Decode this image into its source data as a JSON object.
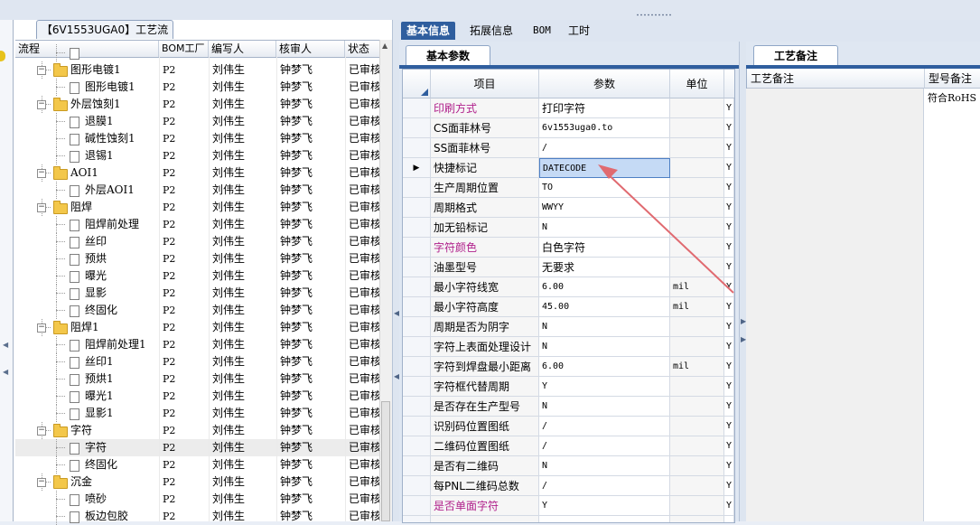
{
  "tree_tab_title": "【6V1553UGA0】工艺流程",
  "tree_columns": [
    "流程",
    "BOM工厂",
    "编写人",
    "核审人",
    "状态"
  ],
  "tree_rows": [
    {
      "level": 0,
      "type": "partial",
      "name": "",
      "factory": "",
      "writer": "",
      "reviewer": "",
      "status": ""
    },
    {
      "level": 1,
      "type": "folder",
      "name": "图形电镀1",
      "factory": "P2",
      "writer": "刘伟生",
      "reviewer": "钟梦飞",
      "status": "已审核"
    },
    {
      "level": 2,
      "type": "doc",
      "name": "图形电镀1",
      "factory": "P2",
      "writer": "刘伟生",
      "reviewer": "钟梦飞",
      "status": "已审核"
    },
    {
      "level": 1,
      "type": "folder",
      "name": "外层蚀刻1",
      "factory": "P2",
      "writer": "刘伟生",
      "reviewer": "钟梦飞",
      "status": "已审核"
    },
    {
      "level": 2,
      "type": "doc",
      "name": "退膜1",
      "factory": "P2",
      "writer": "刘伟生",
      "reviewer": "钟梦飞",
      "status": "已审核"
    },
    {
      "level": 2,
      "type": "doc",
      "name": "碱性蚀刻1",
      "factory": "P2",
      "writer": "刘伟生",
      "reviewer": "钟梦飞",
      "status": "已审核"
    },
    {
      "level": 2,
      "type": "doc",
      "name": "退锡1",
      "factory": "P2",
      "writer": "刘伟生",
      "reviewer": "钟梦飞",
      "status": "已审核"
    },
    {
      "level": 1,
      "type": "folder",
      "name": "AOI1",
      "factory": "P2",
      "writer": "刘伟生",
      "reviewer": "钟梦飞",
      "status": "已审核"
    },
    {
      "level": 2,
      "type": "doc",
      "name": "外层AOI1",
      "factory": "P2",
      "writer": "刘伟生",
      "reviewer": "钟梦飞",
      "status": "已审核"
    },
    {
      "level": 1,
      "type": "folder",
      "name": "阻焊",
      "factory": "P2",
      "writer": "刘伟生",
      "reviewer": "钟梦飞",
      "status": "已审核"
    },
    {
      "level": 2,
      "type": "doc",
      "name": "阻焊前处理",
      "factory": "P2",
      "writer": "刘伟生",
      "reviewer": "钟梦飞",
      "status": "已审核"
    },
    {
      "level": 2,
      "type": "doc",
      "name": "丝印",
      "factory": "P2",
      "writer": "刘伟生",
      "reviewer": "钟梦飞",
      "status": "已审核"
    },
    {
      "level": 2,
      "type": "doc",
      "name": "预烘",
      "factory": "P2",
      "writer": "刘伟生",
      "reviewer": "钟梦飞",
      "status": "已审核"
    },
    {
      "level": 2,
      "type": "doc",
      "name": "曝光",
      "factory": "P2",
      "writer": "刘伟生",
      "reviewer": "钟梦飞",
      "status": "已审核"
    },
    {
      "level": 2,
      "type": "doc",
      "name": "显影",
      "factory": "P2",
      "writer": "刘伟生",
      "reviewer": "钟梦飞",
      "status": "已审核"
    },
    {
      "level": 2,
      "type": "doc",
      "name": "终固化",
      "factory": "P2",
      "writer": "刘伟生",
      "reviewer": "钟梦飞",
      "status": "已审核"
    },
    {
      "level": 1,
      "type": "folder",
      "name": "阻焊1",
      "factory": "P2",
      "writer": "刘伟生",
      "reviewer": "钟梦飞",
      "status": "已审核"
    },
    {
      "level": 2,
      "type": "doc",
      "name": "阻焊前处理1",
      "factory": "P2",
      "writer": "刘伟生",
      "reviewer": "钟梦飞",
      "status": "已审核"
    },
    {
      "level": 2,
      "type": "doc",
      "name": "丝印1",
      "factory": "P2",
      "writer": "刘伟生",
      "reviewer": "钟梦飞",
      "status": "已审核"
    },
    {
      "level": 2,
      "type": "doc",
      "name": "预烘1",
      "factory": "P2",
      "writer": "刘伟生",
      "reviewer": "钟梦飞",
      "status": "已审核"
    },
    {
      "level": 2,
      "type": "doc",
      "name": "曝光1",
      "factory": "P2",
      "writer": "刘伟生",
      "reviewer": "钟梦飞",
      "status": "已审核"
    },
    {
      "level": 2,
      "type": "doc",
      "name": "显影1",
      "factory": "P2",
      "writer": "刘伟生",
      "reviewer": "钟梦飞",
      "status": "已审核"
    },
    {
      "level": 1,
      "type": "folder",
      "name": "字符",
      "factory": "P2",
      "writer": "刘伟生",
      "reviewer": "钟梦飞",
      "status": "已审核"
    },
    {
      "level": 2,
      "type": "doc",
      "name": "字符",
      "factory": "P2",
      "writer": "刘伟生",
      "reviewer": "钟梦飞",
      "status": "已审核",
      "selected": true
    },
    {
      "level": 2,
      "type": "doc",
      "name": "终固化",
      "factory": "P2",
      "writer": "刘伟生",
      "reviewer": "钟梦飞",
      "status": "已审核"
    },
    {
      "level": 1,
      "type": "folder",
      "name": "沉金",
      "factory": "P2",
      "writer": "刘伟生",
      "reviewer": "钟梦飞",
      "status": "已审核"
    },
    {
      "level": 2,
      "type": "doc",
      "name": "喷砂",
      "factory": "P2",
      "writer": "刘伟生",
      "reviewer": "钟梦飞",
      "status": "已审核"
    },
    {
      "level": 2,
      "type": "doc",
      "name": "板边包胶",
      "factory": "P2",
      "writer": "刘伟生",
      "reviewer": "钟梦飞",
      "status": "已审核"
    }
  ],
  "top_tabs": [
    "基本信息",
    "拓展信息",
    "BOM",
    "工时"
  ],
  "basic_subtab": "基本参数",
  "param_columns": [
    "项目",
    "参数",
    "单位"
  ],
  "param_rows": [
    {
      "item": "印刷方式",
      "value": "打印字符",
      "unit": "",
      "extra": "Y",
      "pink": true
    },
    {
      "item": "CS面菲林号",
      "value": "6v1553uga0.to",
      "unit": "",
      "extra": "Y"
    },
    {
      "item": "SS面菲林号",
      "value": "/",
      "unit": "",
      "extra": "Y"
    },
    {
      "item": "快捷标记",
      "value": "DATECODE",
      "unit": "",
      "extra": "Y",
      "current": true
    },
    {
      "item": "生产周期位置",
      "value": "TO",
      "unit": "",
      "extra": "Y"
    },
    {
      "item": "周期格式",
      "value": "WWYY",
      "unit": "",
      "extra": "Y"
    },
    {
      "item": "加无铅标记",
      "value": "N",
      "unit": "",
      "extra": "Y"
    },
    {
      "item": "字符颜色",
      "value": "白色字符",
      "unit": "",
      "extra": "Y",
      "pink": true
    },
    {
      "item": "油墨型号",
      "value": "无要求",
      "unit": "",
      "extra": "Y"
    },
    {
      "item": "最小字符线宽",
      "value": "6.00",
      "unit": "mil",
      "extra": "Y"
    },
    {
      "item": "最小字符高度",
      "value": "45.00",
      "unit": "mil",
      "extra": "Y"
    },
    {
      "item": "周期是否为阴字",
      "value": "N",
      "unit": "",
      "extra": "Y"
    },
    {
      "item": "字符上表面处理设计",
      "value": "N",
      "unit": "",
      "extra": "Y"
    },
    {
      "item": "字符到焊盘最小距离",
      "value": "6.00",
      "unit": "mil",
      "extra": "Y"
    },
    {
      "item": "字符框代替周期",
      "value": "Y",
      "unit": "",
      "extra": "Y"
    },
    {
      "item": "是否存在生产型号",
      "value": "N",
      "unit": "",
      "extra": "Y"
    },
    {
      "item": "识别码位置图纸",
      "value": "/",
      "unit": "",
      "extra": "Y"
    },
    {
      "item": "二维码位置图纸",
      "value": "/",
      "unit": "",
      "extra": "Y"
    },
    {
      "item": "是否有二维码",
      "value": "N",
      "unit": "",
      "extra": "Y"
    },
    {
      "item": "每PNL二维码总数",
      "value": "/",
      "unit": "",
      "extra": "Y"
    },
    {
      "item": "是否单面字符",
      "value": "Y",
      "unit": "",
      "extra": "Y",
      "pink": true
    },
    {
      "item": "",
      "value": "",
      "unit": "",
      "extra": ""
    }
  ],
  "remark_tab": "工艺备注",
  "remark_columns": [
    "工艺备注",
    "型号备注"
  ],
  "remark_value": "符合RoHS",
  "colors": {
    "accent": "#2f5e9e",
    "pink": "#b0208b",
    "arrow": "#e06a70",
    "folder": "#f3c74a"
  },
  "icons": [
    "folder-icon",
    "doc-icon",
    "collapse-icon",
    "scroll-up-icon",
    "row-pointer-icon",
    "splitter-arrow-icon",
    "annotation-arrow"
  ]
}
